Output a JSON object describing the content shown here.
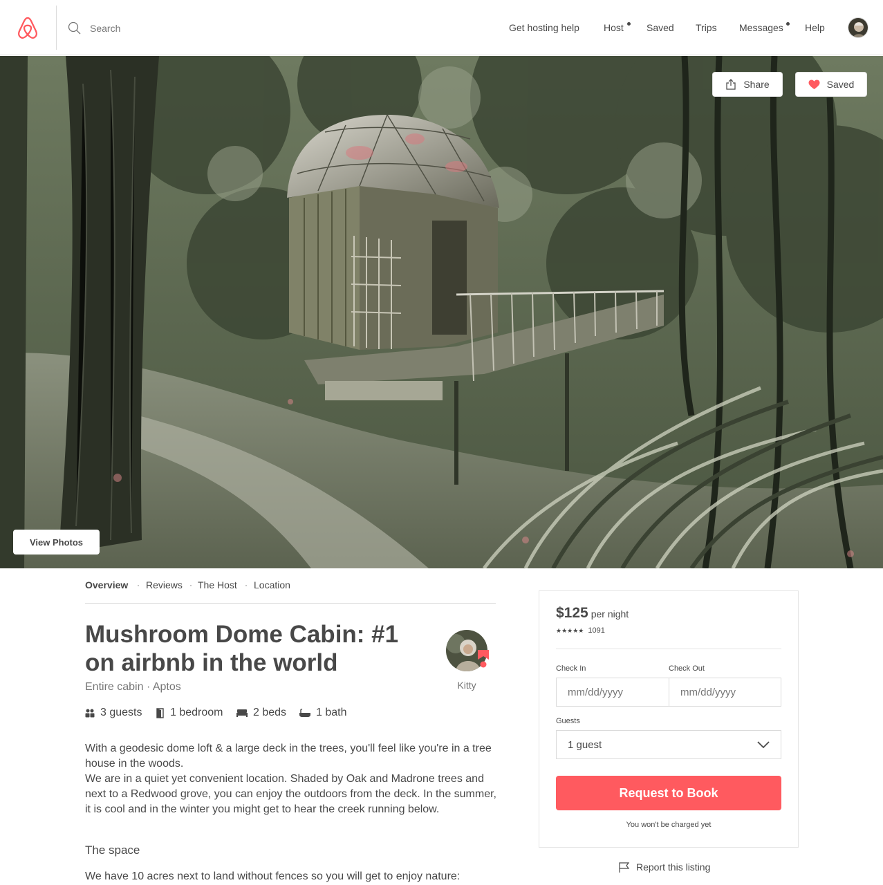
{
  "header": {
    "logo_icon": "airbnb-belo-icon",
    "search_placeholder": "Search",
    "nav": [
      {
        "label": "Get hosting help",
        "dot": false
      },
      {
        "label": "Host",
        "dot": true
      },
      {
        "label": "Saved",
        "dot": false
      },
      {
        "label": "Trips",
        "dot": false
      },
      {
        "label": "Messages",
        "dot": true
      },
      {
        "label": "Help",
        "dot": false
      }
    ],
    "avatar_icon": "user-avatar-icon"
  },
  "hero": {
    "share_label": "Share",
    "saved_label": "Saved",
    "view_photos_label": "View Photos"
  },
  "subnav": {
    "items": [
      "Overview",
      "Reviews",
      "The Host",
      "Location"
    ],
    "separator": "·"
  },
  "listing": {
    "title": "Mushroom Dome Cabin: #1 on airbnb in the world",
    "subtitle": "Entire cabin · Aptos",
    "host_name": "Kitty",
    "amenities": [
      {
        "icon": "guests-icon",
        "label": "3 guests"
      },
      {
        "icon": "door-icon",
        "label": "1 bedroom"
      },
      {
        "icon": "bed-icon",
        "label": "2 beds"
      },
      {
        "icon": "bath-icon",
        "label": "1 bath"
      }
    ],
    "description": "With a geodesic dome loft & a large deck in the trees, you'll feel like you're in a tree house in the woods.\nWe are in a quiet yet convenient location. Shaded by Oak and Madrone trees and next to a Redwood grove, you can enjoy the outdoors from the deck. In the summer, it is cool and in the winter you might get to hear the creek running below.",
    "space_title": "The space",
    "space_text": "We have 10 acres next to land without fences so you will get to enjoy nature:"
  },
  "booking": {
    "price": "$125",
    "per_night": "per night",
    "stars": "★★★★★",
    "review_count": "1091",
    "check_in_label": "Check In",
    "check_out_label": "Check Out",
    "date_placeholder": "mm/dd/yyyy",
    "guests_label": "Guests",
    "guests_value": "1 guest",
    "book_label": "Request to Book",
    "no_charge": "You won't be charged yet",
    "report_label": "Report this listing"
  },
  "colors": {
    "brand": "#ff5a5f",
    "text": "#484848",
    "muted": "#767676"
  }
}
